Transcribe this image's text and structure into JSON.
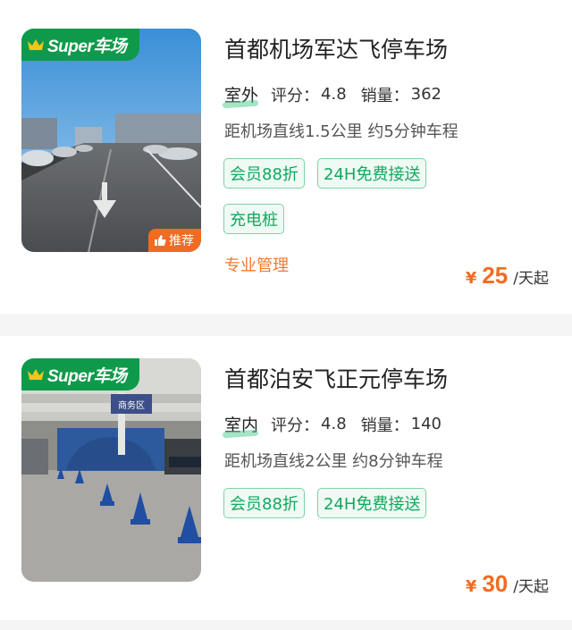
{
  "listings": [
    {
      "badge": "Super车场",
      "name": "首都机场军达飞停车场",
      "location_type": "室外",
      "rating_label": "评分：",
      "rating": "4.8",
      "sales_label": "销量：",
      "sales": "362",
      "distance": "距机场直线1.5公里 约5分钟车程",
      "tags": [
        "会员88折",
        "24H免费接送",
        "充电桩"
      ],
      "feature": "专业管理",
      "recommend_label": "推荐",
      "currency": "¥",
      "price": "25",
      "price_unit": "/天起",
      "image_icon": "parking-lot-photo"
    },
    {
      "badge": "Super车场",
      "name": "首都泊安飞正元停车场",
      "location_type": "室内",
      "rating_label": "评分：",
      "rating": "4.8",
      "sales_label": "销量：",
      "sales": "140",
      "distance": "距机场直线2公里 约8分钟车程",
      "tags": [
        "会员88折",
        "24H免费接送"
      ],
      "currency": "¥",
      "price": "30",
      "price_unit": "/天起",
      "image_icon": "garage-photo",
      "sign_text": "商务区"
    }
  ],
  "colors": {
    "brand_green": "#0e9a4a",
    "tag_green": "#11a860",
    "price_orange": "#f26b22"
  }
}
